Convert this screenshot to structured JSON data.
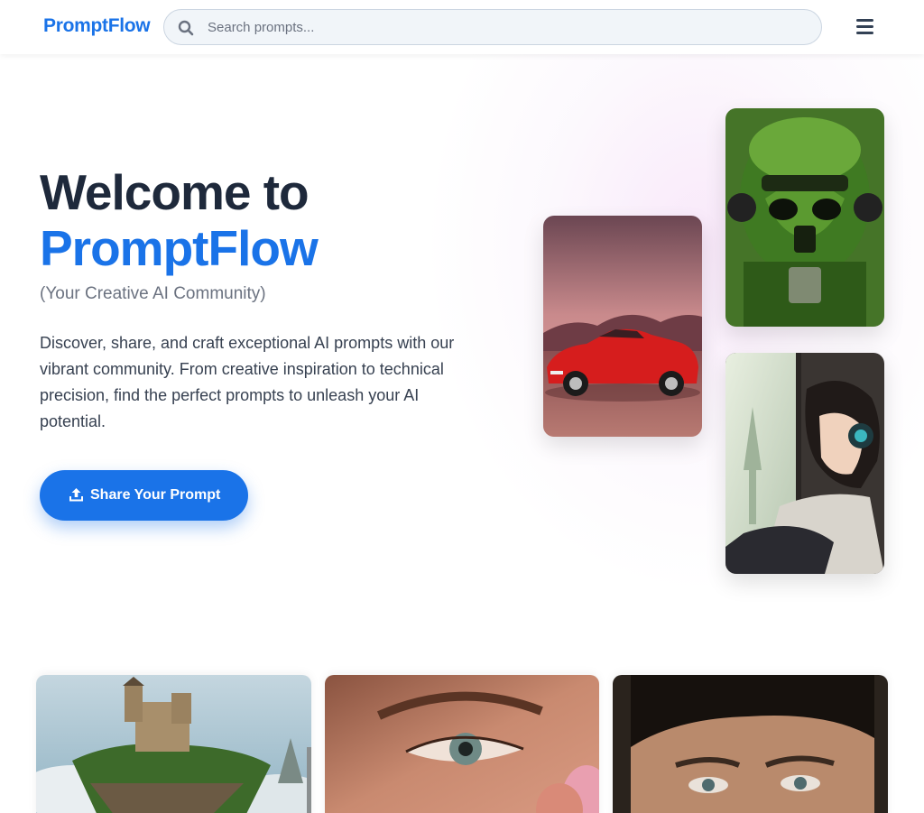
{
  "brand": {
    "name": "PromptFlow",
    "color": "#1a73e8"
  },
  "search": {
    "placeholder": "Search prompts...",
    "icon": "search-icon"
  },
  "menu": {
    "icon": "hamburger-menu-icon"
  },
  "hero": {
    "title_line1": "Welcome to",
    "title_line2": "PromptFlow",
    "subtitle": "(Your Creative AI Community)",
    "description": "Discover, share, and craft exceptional AI prompts with our vibrant community. From creative inspiration to technical precision, find the perfect prompts to unleash your AI potential.",
    "cta_label": "Share Your Prompt",
    "cta_icon": "upload-icon"
  },
  "hero_images": [
    {
      "name": "red-vintage-car"
    },
    {
      "name": "moss-covered-trooper-helmet"
    },
    {
      "name": "anime-girl-with-headphones"
    }
  ],
  "gallery": [
    {
      "name": "floating-island-castle"
    },
    {
      "name": "freckled-face-closeup"
    },
    {
      "name": "man-portrait-closeup"
    }
  ],
  "colors": {
    "accent": "#1a73e8",
    "heading": "#1e293b",
    "muted": "#6b7280"
  }
}
